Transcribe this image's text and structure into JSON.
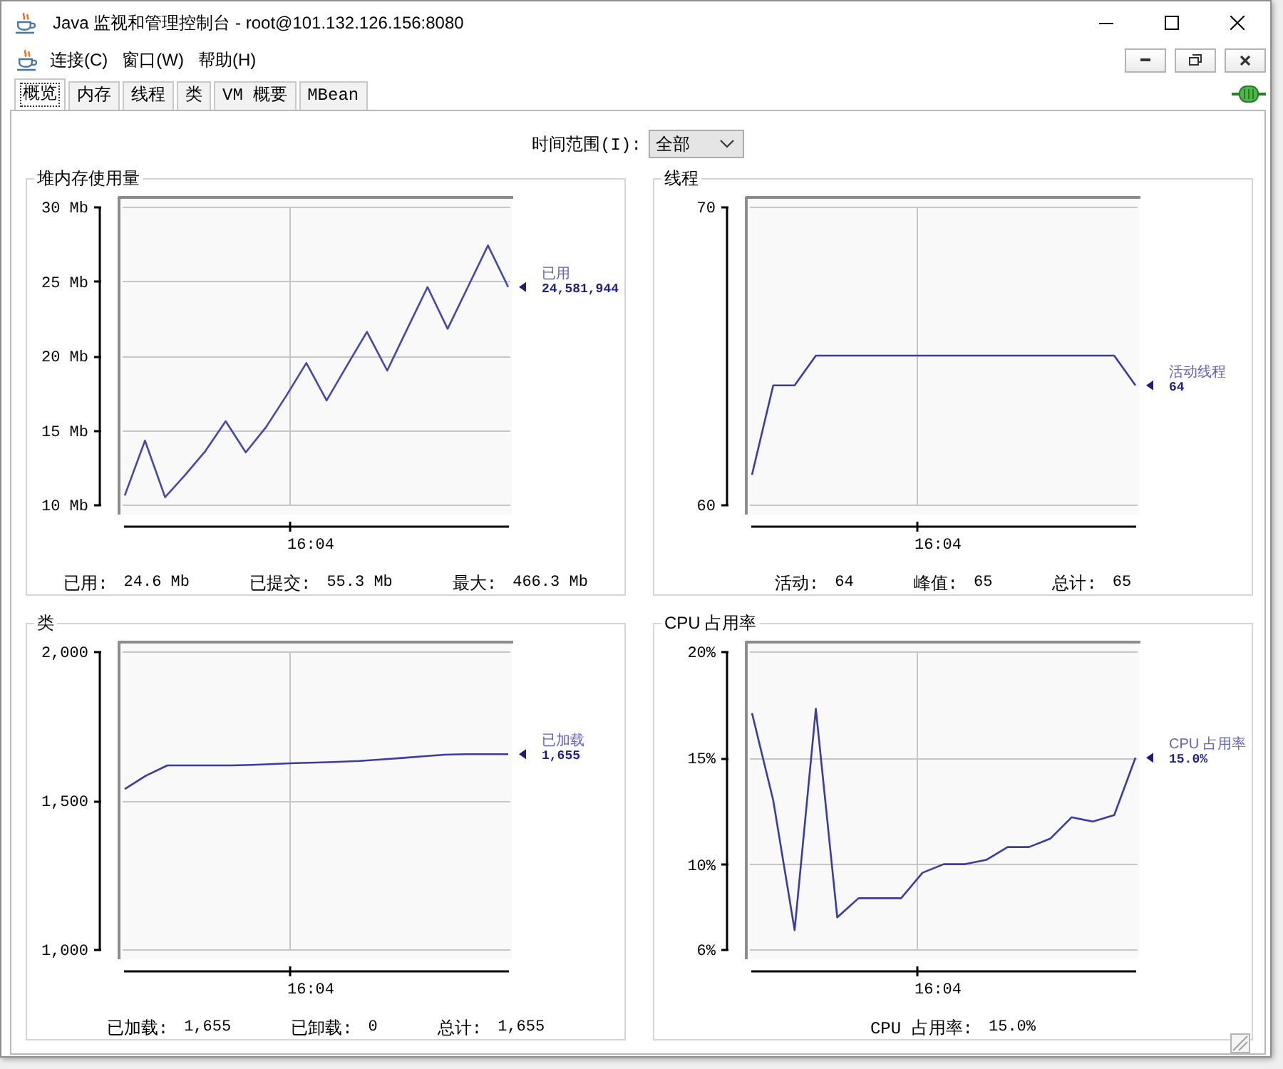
{
  "window": {
    "title": "Java 监视和管理控制台 - root@101.132.126.156:8080"
  },
  "menu": [
    {
      "label": "连接(C)"
    },
    {
      "label": "窗口(W)"
    },
    {
      "label": "帮助(H)"
    }
  ],
  "tabs": [
    {
      "label": "概览",
      "selected": true
    },
    {
      "label": "内存",
      "selected": false
    },
    {
      "label": "线程",
      "selected": false
    },
    {
      "label": "类",
      "selected": false
    },
    {
      "label": "VM 概要",
      "selected": false
    },
    {
      "label": "MBean",
      "selected": false
    }
  ],
  "connection": {
    "connected": true
  },
  "time_range": {
    "label": "时间范围(I):",
    "value": "全部"
  },
  "panels": [
    {
      "title": "堆内存使用量",
      "legend_value": "24,581,944",
      "chart_data": {
        "type": "line",
        "grid": true,
        "series": [
          {
            "name": "已用",
            "color": "#4646b0",
            "values": [
              10.6,
              14.3,
              10.5,
              12.0,
              13.6,
              15.6,
              13.5,
              15.2,
              17.3,
              19.5,
              17.0,
              19.3,
              21.6,
              19.0,
              21.8,
              24.6,
              21.8,
              24.6,
              27.4,
              24.6
            ]
          }
        ],
        "ylim": [
          10,
          30
        ],
        "yticks": [
          {
            "value": 10,
            "label": "10 Mb"
          },
          {
            "value": 15,
            "label": "15 Mb"
          },
          {
            "value": 20,
            "label": "20 Mb"
          },
          {
            "value": 25,
            "label": "25 Mb"
          },
          {
            "value": 30,
            "label": "30 Mb"
          }
        ],
        "annotations": [
          "16:04"
        ]
      },
      "summary": [
        {
          "label": "已用:",
          "value": "24.6 Mb"
        },
        {
          "label": "已提交:",
          "value": "55.3 Mb"
        },
        {
          "label": "最大:",
          "value": "466.3 Mb"
        }
      ]
    },
    {
      "title": "线程",
      "legend_value": "64",
      "chart_data": {
        "type": "line",
        "grid": true,
        "series": [
          {
            "name": "活动线程",
            "color": "#3a3aa8",
            "values": [
              61,
              64,
              64,
              65,
              65,
              65,
              65,
              65,
              65,
              65,
              65,
              65,
              65,
              65,
              65,
              65,
              65,
              65,
              64
            ]
          }
        ],
        "ylim": [
          60,
          70
        ],
        "yticks": [
          {
            "value": 60,
            "label": "60"
          },
          {
            "value": 70,
            "label": "70"
          }
        ],
        "annotations": [
          "16:04"
        ]
      },
      "summary": [
        {
          "label": "活动:",
          "value": "64"
        },
        {
          "label": "峰值:",
          "value": "65"
        },
        {
          "label": "总计:",
          "value": "65"
        }
      ]
    },
    {
      "title": "类",
      "legend_value": "1,655",
      "chart_data": {
        "type": "line",
        "grid": true,
        "series": [
          {
            "name": "已加载",
            "color": "#3a3aa8",
            "values": [
              1538,
              1583,
              1617,
              1617,
              1617,
              1617,
              1619,
              1622,
              1625,
              1627,
              1629,
              1632,
              1637,
              1642,
              1648,
              1653,
              1655,
              1655,
              1655
            ]
          }
        ],
        "ylim": [
          1000,
          2000
        ],
        "yticks": [
          {
            "value": 1000,
            "label": "1,000"
          },
          {
            "value": 1500,
            "label": "1,500"
          },
          {
            "value": 2000,
            "label": "2,000"
          }
        ],
        "annotations": [
          "16:04"
        ]
      },
      "summary": [
        {
          "label": "已加载:",
          "value": "1,655"
        },
        {
          "label": "已卸载:",
          "value": "0"
        },
        {
          "label": "总计:",
          "value": "1,655"
        }
      ]
    },
    {
      "title": "CPU 占用率",
      "legend_value": "15.0%",
      "chart_data": {
        "type": "line",
        "grid": true,
        "series": [
          {
            "name": "CPU 占用率",
            "color": "#3a3aa8",
            "values": [
              17.1,
              13.0,
              6.9,
              17.3,
              7.5,
              8.4,
              8.4,
              8.4,
              9.6,
              10.0,
              10.0,
              10.2,
              10.8,
              10.8,
              11.2,
              12.2,
              12.0,
              12.3,
              15.0
            ]
          }
        ],
        "ylim": [
          6,
          20
        ],
        "yticks": [
          {
            "value": 6,
            "label": "6%"
          },
          {
            "value": 10,
            "label": "10%"
          },
          {
            "value": 15,
            "label": "15%"
          },
          {
            "value": 20,
            "label": "20%"
          }
        ],
        "annotations": [
          "16:04"
        ]
      },
      "summary": [
        {
          "label": "CPU 占用率:",
          "value": "15.0%"
        }
      ]
    }
  ]
}
